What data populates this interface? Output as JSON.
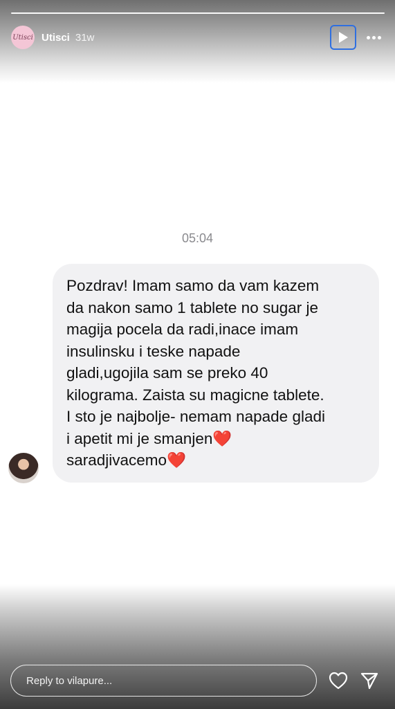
{
  "header": {
    "avatar_text": "Utisci",
    "username": "Utisci",
    "time_ago": "31w",
    "play_icon": "play-icon",
    "more_icon": "more-dots-icon"
  },
  "message": {
    "timestamp": "05:04",
    "lines": [
      "Pozdrav! Imam samo da vam kazem",
      "da nakon samo 1 tablete no sugar je",
      "magija pocela da radi,inace imam",
      "insulinsku i teske napade",
      "gladi,ugojila sam se preko 40",
      "kilograma. Zaista su magicne tablete.",
      "I sto je najbolje- nemam napade gladi",
      "i apetit mi je smanjen",
      "saradjivacemo"
    ],
    "emoji": "❤️"
  },
  "footer": {
    "reply_placeholder": "Reply to vilapure...",
    "like_icon": "heart-icon",
    "share_icon": "send-icon"
  },
  "colors": {
    "bubble": "#f1f1f3",
    "accent_outline": "#2f6fe0",
    "heart": "#e0242f"
  }
}
